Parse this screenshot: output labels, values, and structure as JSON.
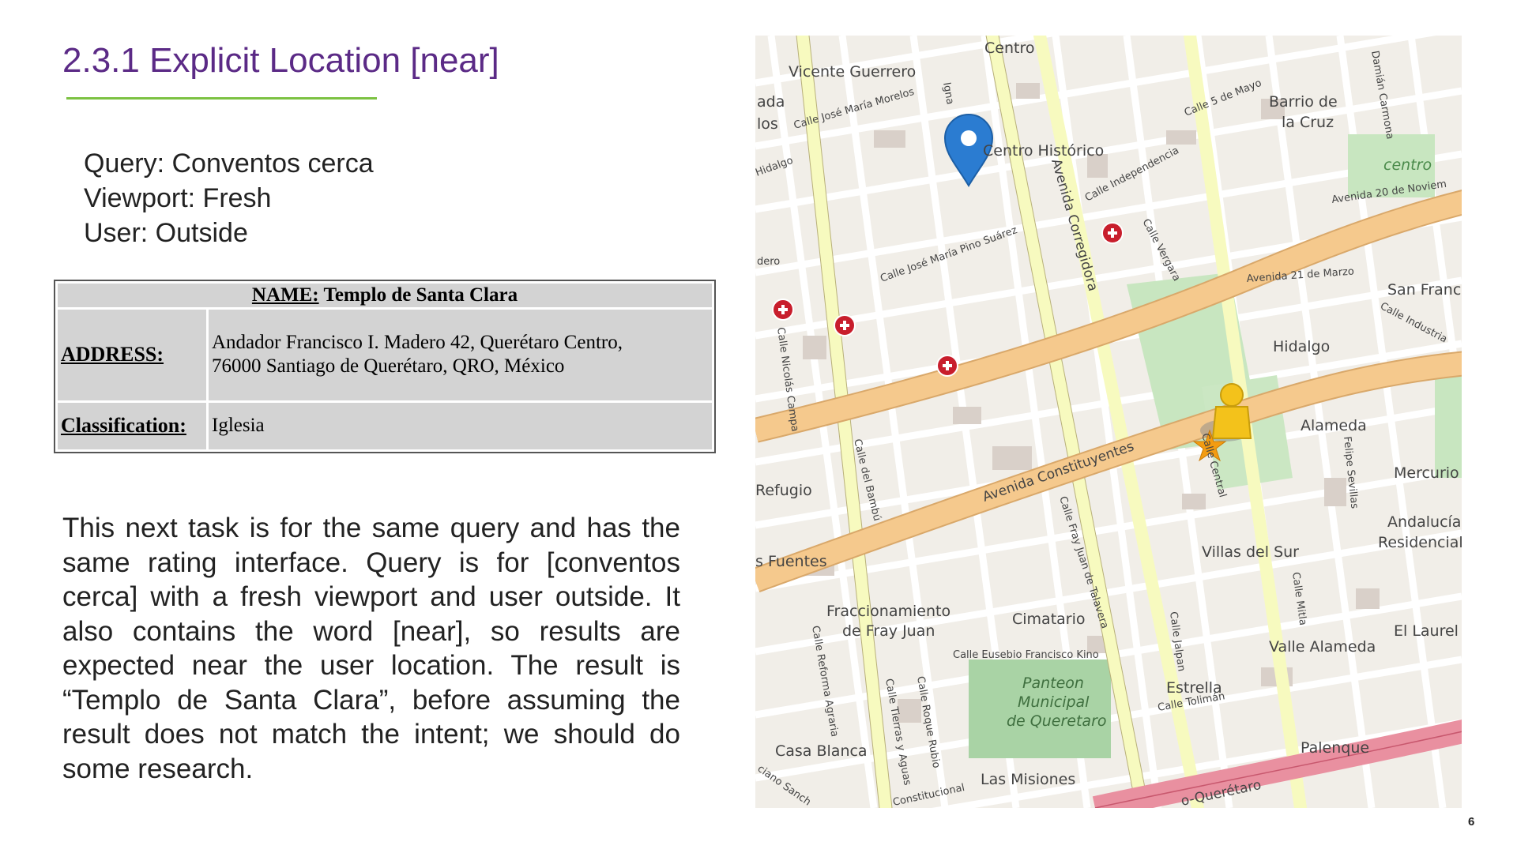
{
  "slide": {
    "title": "2.3.1 Explicit Location [near]",
    "query_line": "Query: Conventos cerca",
    "viewport_line": "Viewport: Fresh",
    "user_line": "User: Outside",
    "paragraph": "This next task is for the same query and has the same rating interface. Query is for [conventos cerca] with a fresh viewport and user outside. It also contains the word [near], so results are expected near the user location. The result is “Templo de Santa Clara”, before assuming the result does not match the intent; we should do some research.",
    "page_number": "6"
  },
  "card": {
    "name_label": "NAME:",
    "name_value": "Templo de Santa Clara",
    "address_label": "ADDRESS:",
    "address_line1": "Andador Francisco I. Madero 42, Querétaro Centro,",
    "address_line2": "76000 Santiago de Querétaro, QRO, México",
    "classification_label": "Classification:",
    "classification_value": "Iglesia"
  },
  "map": {
    "labels": {
      "centro": "Centro",
      "vicente_guerrero": "Vicente Guerrero",
      "ada": "ada",
      "los": "los",
      "jose_maria_morelos": "Calle José María Morelos",
      "hidalgo_left": "Hidalgo",
      "centro_historico": "Centro Histórico",
      "calle_5_de_mayo": "Calle 5 de Mayo",
      "barrio_de_la_cruz_1": "Barrio de",
      "barrio_de_la_cruz_2": "la Cruz",
      "damian_carmona": "Damián Carmona",
      "centro_park": "centro",
      "av_20_nov": "Avenida 20 de Noviem",
      "calle_independencia": "Calle Independencia",
      "avenida_corregidora": "Avenida Corregidora",
      "calle_vergara": "Calle Vergara",
      "pino_suarez": "Calle José María Pino Suárez",
      "dero": "dero",
      "av_21_marzo": "Avenida 21 de Marzo",
      "san_franc": "San Franc",
      "calle_industria": "Calle Industria",
      "nicolas_campa": "Calle Nicolás Campa",
      "hidalgo_right": "Hidalgo",
      "alameda": "Alameda",
      "felipe_sevillas": "Felipe Sevillas",
      "av_constituyentes": "Avenida Constituyentes",
      "calle_central": "Calle Central",
      "refugio": "Refugio",
      "calle_del_bambu": "Calle del Bambú",
      "fray_juan": "Calle Fray Juan de Talavera",
      "mercurio": "Mercurio",
      "andalucia_1": "Andalucía",
      "andalucia_2": "Residencial",
      "fuentes": "s Fuentes",
      "villas_del_sur": "Villas del Sur",
      "calle_mitla": "Calle Mitla",
      "fraccionamiento_1": "Fraccionamiento",
      "fraccionamiento_2": "de Fray Juan",
      "cimatario": "Cimatario",
      "calle_jalpan": "Calle Jalpan",
      "valle_alameda": "Valle Alameda",
      "el_laurel": "El Laurel",
      "eusebio_kino": "Calle Eusebio Francisco Kino",
      "reforma_agraria": "Calle Reforma Agraria",
      "tierras_y_aguas": "Calle Tierras y Aguas",
      "roque_rubio": "Calle Roque Rubio",
      "panteon_1": "Panteon",
      "panteon_2": "Municipal",
      "panteon_3": "de Queretaro",
      "estrella": "Estrella",
      "calle_toliman": "Calle Tolimán",
      "casa_blanca": "Casa Blanca",
      "palenque": "Palenque",
      "las_misiones": "Las Misiones",
      "constitucional": "Constitucional",
      "queretaro_road": "o-Querétaro",
      "ciano_sanch": "ciano Sanch",
      "ignacio": "Igna"
    },
    "colors": {
      "background": "#f1eee8",
      "major_road": "#f5c98d",
      "secondary_road": "#f7fabf",
      "highway": "#e990a0",
      "park": "#c8e6c0",
      "cemetery": "#a9d3a5",
      "pin": "#2b7cd1",
      "star": "#f39c12",
      "pegman": "#f3c21b",
      "hospital": "#c81e2c"
    }
  }
}
